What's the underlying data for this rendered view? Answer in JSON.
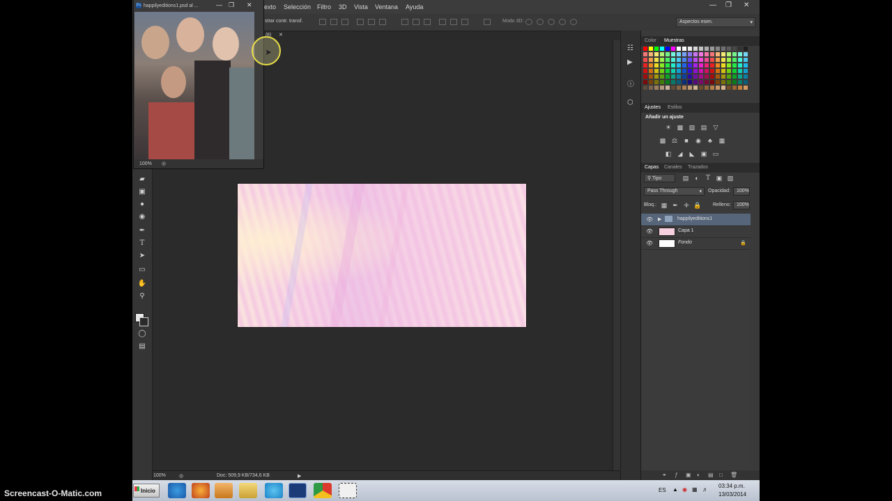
{
  "menu": {
    "items": [
      "exto",
      "Selección",
      "Filtro",
      "3D",
      "Vista",
      "Ventana",
      "Ayuda"
    ]
  },
  "options": {
    "transform_label": "strar contr. transf.",
    "mode3d_label": "Modo 3D:",
    "workspace": "Aspectos esen."
  },
  "floating_doc": {
    "title": "happilyeditions1.psd al ...",
    "zoom": "100%",
    "tab_suffix": "/8)"
  },
  "status": {
    "zoom": "100%",
    "doc_info": "Doc: 509,9 KB/734,6 KB"
  },
  "panels": {
    "color_tabs": [
      "Color",
      "Muestras"
    ],
    "adjust_tabs": [
      "Ajustes",
      "Estilos"
    ],
    "adjust_title": "Añadir un ajuste",
    "layer_tabs": [
      "Capas",
      "Canales",
      "Trazados"
    ],
    "filter_label": "Tipo",
    "blend_mode": "Pass Through",
    "opacity_label": "Opacidad:",
    "opacity_value": "100%",
    "lock_label": "Bloq.:",
    "fill_label": "Relleno:",
    "fill_value": "100%",
    "layers": [
      {
        "name": "happilyeditions1",
        "type": "group",
        "selected": true
      },
      {
        "name": "Capa 1",
        "type": "layer"
      },
      {
        "name": "Fondo",
        "type": "background",
        "locked": true
      }
    ]
  },
  "taskbar": {
    "start_label": "Inicio",
    "lang": "ES",
    "time": "03:34 p.m.",
    "date": "13/03/2014"
  },
  "watermark": "Screencast-O-Matic.com",
  "colors": {
    "accent": "#e6dd47",
    "panel_bg": "#3a3a3a",
    "workspace_bg": "#2b2b2b"
  }
}
